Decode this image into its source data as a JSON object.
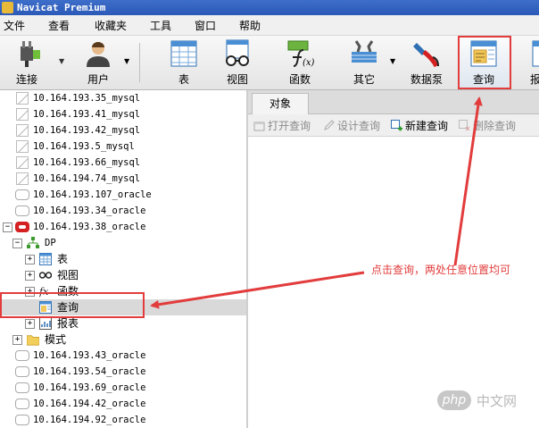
{
  "window": {
    "title": "Navicat Premium"
  },
  "menu": [
    "文件",
    "查看",
    "收藏夹",
    "工具",
    "窗口",
    "帮助"
  ],
  "toolbar": {
    "connect": "连接",
    "user": "用户",
    "table": "表",
    "view": "视图",
    "function": "函数",
    "other": "其它",
    "datapump": "数据泵",
    "query": "查询",
    "report": "报"
  },
  "tree": {
    "connections_top": [
      "10.164.193.35_mysql",
      "10.164.193.41_mysql",
      "10.164.193.42_mysql",
      "10.164.193.5_mysql",
      "10.164.193.66_mysql",
      "10.164.194.74_mysql",
      "10.164.193.107_oracle",
      "10.164.193.34_oracle"
    ],
    "active_connection": "10.164.193.38_oracle",
    "schema": "DP",
    "schema_children": [
      "表",
      "视图",
      "函数",
      "查询",
      "报表"
    ],
    "mode": "模式",
    "connections_bottom": [
      "10.164.193.43_oracle",
      "10.164.193.54_oracle",
      "10.164.193.69_oracle",
      "10.164.194.42_oracle",
      "10.164.194.92_oracle"
    ]
  },
  "right_pane": {
    "tab": "对象",
    "buttons": [
      "打开查询",
      "设计查询",
      "新建查询",
      "删除查询"
    ]
  },
  "annotation": "点击查询，两处任意位置均可",
  "watermark": {
    "logo": "php",
    "text": "中文网"
  },
  "colors": {
    "annotation_red": "#e23c3c",
    "titlebar_blue": "#2a59b8",
    "selection_gray": "#d9d9d9",
    "oracle_red": "#d42020"
  }
}
